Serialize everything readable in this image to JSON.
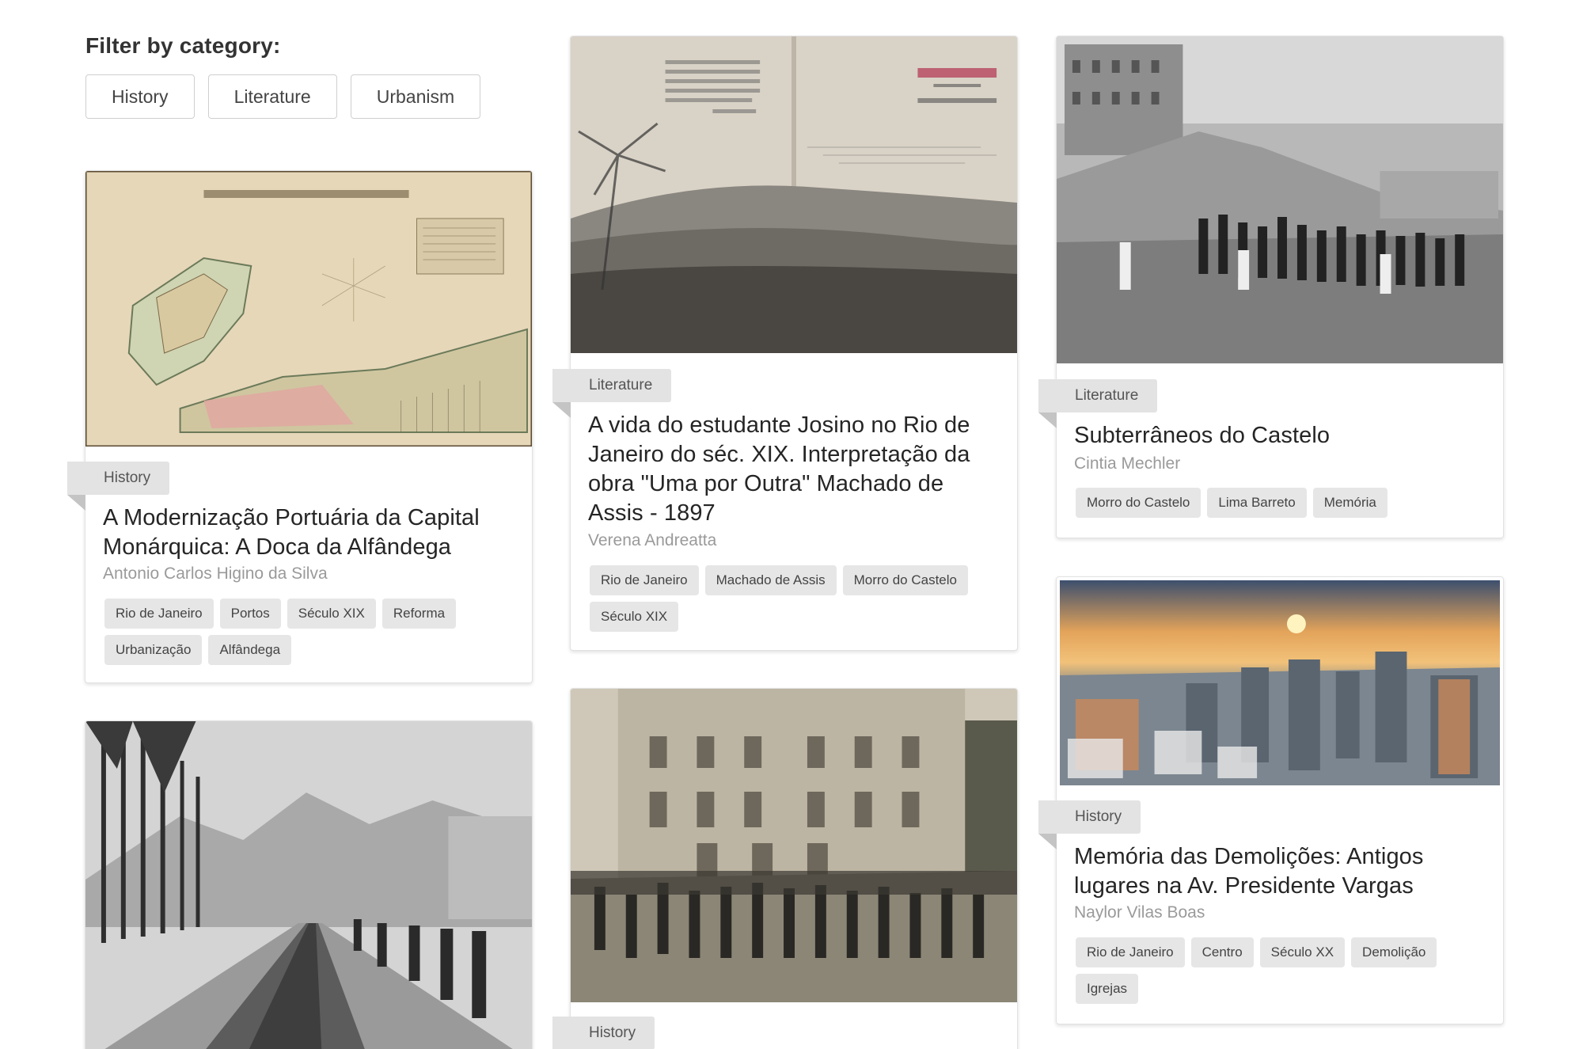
{
  "filter": {
    "title": "Filter by category:",
    "buttons": [
      "History",
      "Literature",
      "Urbanism"
    ]
  },
  "cards": [
    {
      "category": "History",
      "title": "A Modernização Portuária da Capital Monárquica: A Doca da Alfândega",
      "author": "Antonio Carlos Higino da Silva",
      "keywords": [
        "Rio de Janeiro",
        "Portos",
        "Século XIX",
        "Reforma",
        "Urbanização",
        "Alfândega"
      ],
      "image_icon": "map-image"
    },
    {
      "category": "Literature",
      "title": "A vida do estudante Josino no Rio de Janeiro do séc. XIX. Interpretação da obra \"Uma por Outra\" Machado de Assis - 1897",
      "author": "Verena Andreatta",
      "keywords": [
        "Rio de Janeiro",
        "Machado de Assis",
        "Morro do Castelo",
        "Século XIX"
      ],
      "image_icon": "book-cover-image"
    },
    {
      "category": "Literature",
      "title": "Subterrâneos do Castelo",
      "author": "Cintia Mechler",
      "keywords": [
        "Morro do Castelo",
        "Lima Barreto",
        "Memória"
      ],
      "image_icon": "historic-photo-image"
    },
    {
      "category": "History",
      "title": "Memória das Demolições: Antigos lugares na Av. Presidente Vargas",
      "author": "Naylor Vilas Boas",
      "keywords": [
        "Rio de Janeiro",
        "Centro",
        "Século XX",
        "Demolição",
        "Igrejas"
      ],
      "image_icon": "aerial-city-image"
    },
    {
      "category": "History",
      "image_icon": "crowd-photo-image"
    },
    {
      "image_icon": "canal-photo-image"
    }
  ],
  "colors": {
    "tag_bg": "#e3e3e3",
    "keyword_bg": "#e6e6e6",
    "author": "#9a9a9a",
    "border": "#e2e2e2"
  }
}
